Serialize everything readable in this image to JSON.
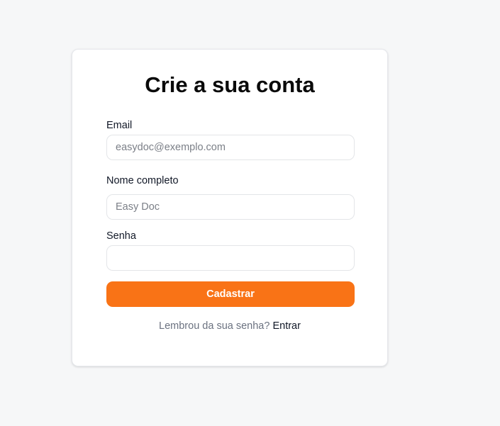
{
  "signup_form": {
    "title": "Crie a sua conta",
    "email": {
      "label": "Email",
      "placeholder": "easydoc@exemplo.com",
      "value": ""
    },
    "full_name": {
      "label": "Nome completo",
      "placeholder": "Easy Doc",
      "value": ""
    },
    "password": {
      "label": "Senha",
      "placeholder": "",
      "value": ""
    },
    "submit_label": "Cadastrar",
    "footer_text": "Lembrou da sua senha?",
    "login_link_label": "Entrar"
  },
  "colors": {
    "background": "#f6f7f8",
    "card": "#ffffff",
    "accent": "#f97316",
    "text_primary": "#111827",
    "text_muted": "#6b7280"
  }
}
